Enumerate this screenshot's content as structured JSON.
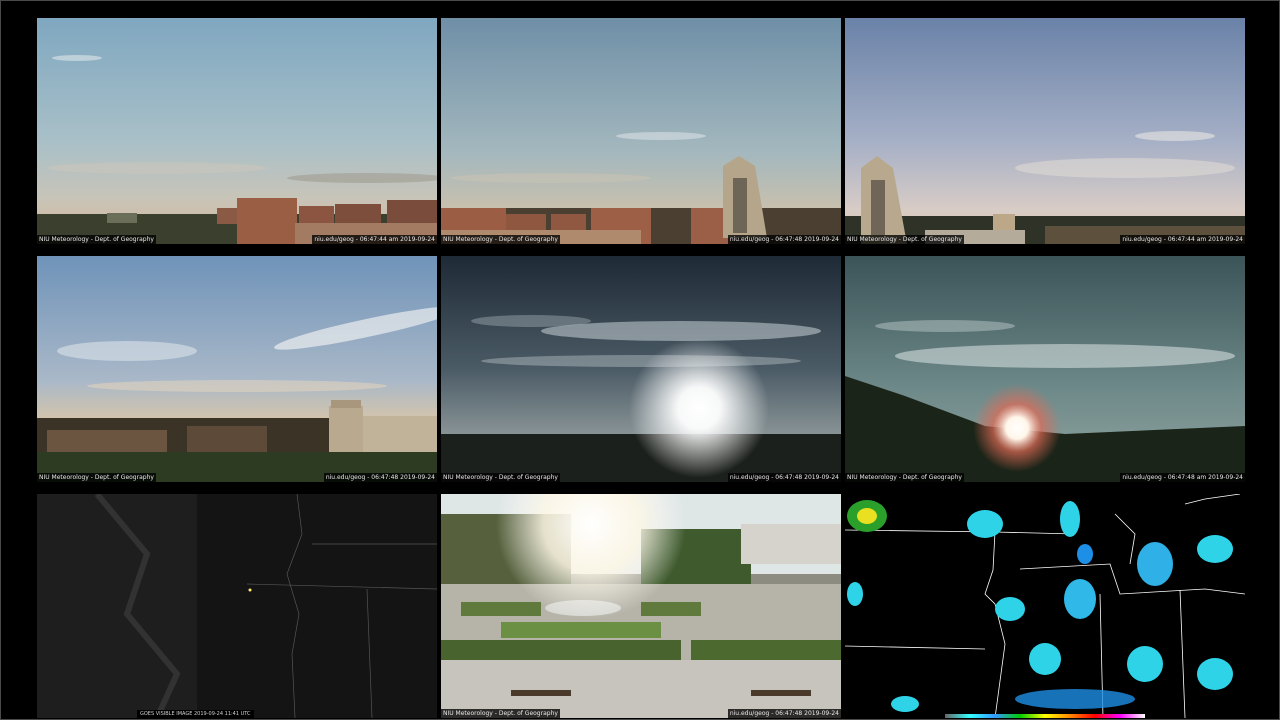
{
  "cams": {
    "cam1": {
      "left": "NIU Meteorology - Dept. of Geography",
      "right": "niu.edu/geog - 06:47:44 am 2019-09-24"
    },
    "cam2": {
      "left": "NIU Meteorology - Dept. of Geography",
      "right": "niu.edu/geog - 06:47:48 2019-09-24"
    },
    "cam3": {
      "left": "NIU Meteorology - Dept. of Geography",
      "right": "niu.edu/geog - 06:47:44 am 2019-09-24"
    },
    "cam4": {
      "left": "NIU Meteorology - Dept. of Geography",
      "right": "niu.edu/geog - 06:47:48 2019-09-24"
    },
    "cam5": {
      "left": "NIU Meteorology - Dept. of Geography",
      "right": "niu.edu/geog - 06:47:48 2019-09-24"
    },
    "cam6": {
      "left": "NIU Meteorology - Dept. of Geography",
      "right": "niu.edu/geog - 06:47:48 am 2019-09-24"
    },
    "cam8": {
      "left": "NIU Meteorology - Dept. of Geography",
      "right": "niu.edu/geog - 06:47:48 2019-09-24"
    }
  },
  "satellite": {
    "caption": "GOES VISIBLE IMAGE  2019-09-24  11:41 UTC"
  },
  "colors": {
    "frame": "#4a4a4a",
    "background": "#000000"
  }
}
